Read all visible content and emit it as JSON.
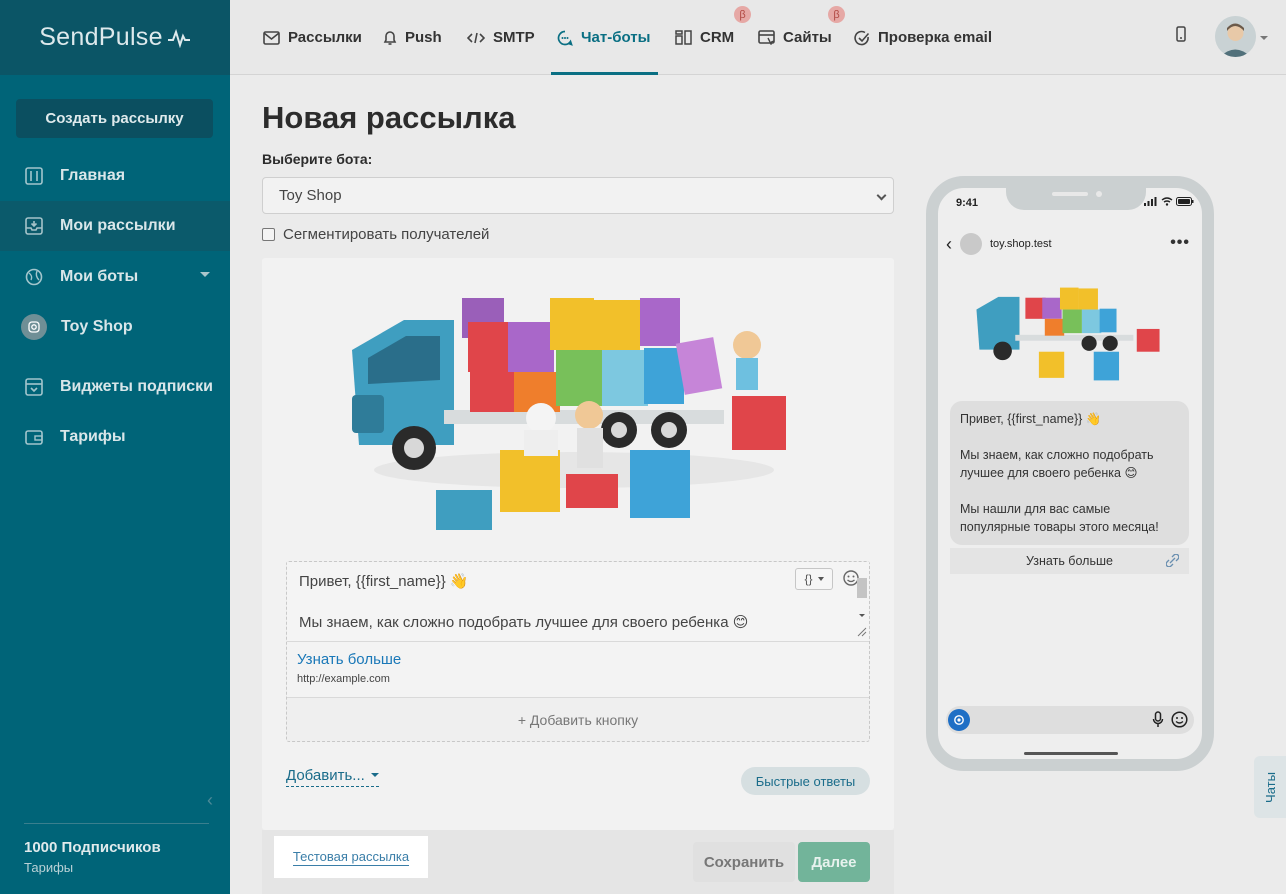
{
  "brand": {
    "name": "SendPulse"
  },
  "sidebar": {
    "create_button": "Создать рассылку",
    "items": [
      {
        "label": "Главная",
        "icon": "sliders-icon"
      },
      {
        "label": "Мои рассылки",
        "icon": "inbox-icon"
      },
      {
        "label": "Мои боты",
        "icon": "globe-icon"
      },
      {
        "label": "Toy Shop",
        "icon": "instagram-icon"
      },
      {
        "label": "Виджеты подписки",
        "icon": "widget-icon"
      },
      {
        "label": "Тарифы",
        "icon": "wallet-icon"
      }
    ],
    "subscribers": "1000 Подписчиков",
    "tariffs": "Тарифы"
  },
  "topnav": {
    "items": [
      {
        "label": "Рассылки",
        "icon": "mail-icon"
      },
      {
        "label": "Push",
        "icon": "bell-icon"
      },
      {
        "label": "SMTP",
        "icon": "code-icon"
      },
      {
        "label": "Чат-боты",
        "icon": "chat-icon",
        "active": true
      },
      {
        "label": "CRM",
        "icon": "crm-icon",
        "beta": "β"
      },
      {
        "label": "Сайты",
        "icon": "site-icon",
        "beta": "β"
      },
      {
        "label": "Проверка email",
        "icon": "check-icon"
      }
    ]
  },
  "page": {
    "title": "Новая рассылка",
    "bot_label": "Выберите бота:",
    "bot_value": "Toy Shop",
    "segment_label": "Сегментировать получателей"
  },
  "editor": {
    "text_line1": "Привет,  {{first_name}} 👋",
    "text_line2": "Мы знаем, как сложно подобрать лучшее для своего ребенка 😊",
    "button_title": "Узнать больше",
    "button_url": "http://example.com",
    "add_button": "+ Добавить кнопку",
    "add_more": "Добавить...",
    "quick_replies": "Быстрые ответы"
  },
  "footer": {
    "test": "Тестовая рассылка",
    "save": "Сохранить",
    "next": "Далее"
  },
  "phone": {
    "time": "9:41",
    "contact": "toy.shop.test",
    "msg1": "Привет,  {{first_name}} 👋",
    "msg2": "Мы знаем, как сложно подобрать лучшее для своего ребенка 😊",
    "msg3": "Мы нашли для вас самые популярные товары этого месяца!",
    "button": "Узнать больше"
  },
  "chats_tab": "Чаты",
  "colors": {
    "sidebar": "#006478",
    "accent": "#0a6f83",
    "next": "#72b49a"
  }
}
